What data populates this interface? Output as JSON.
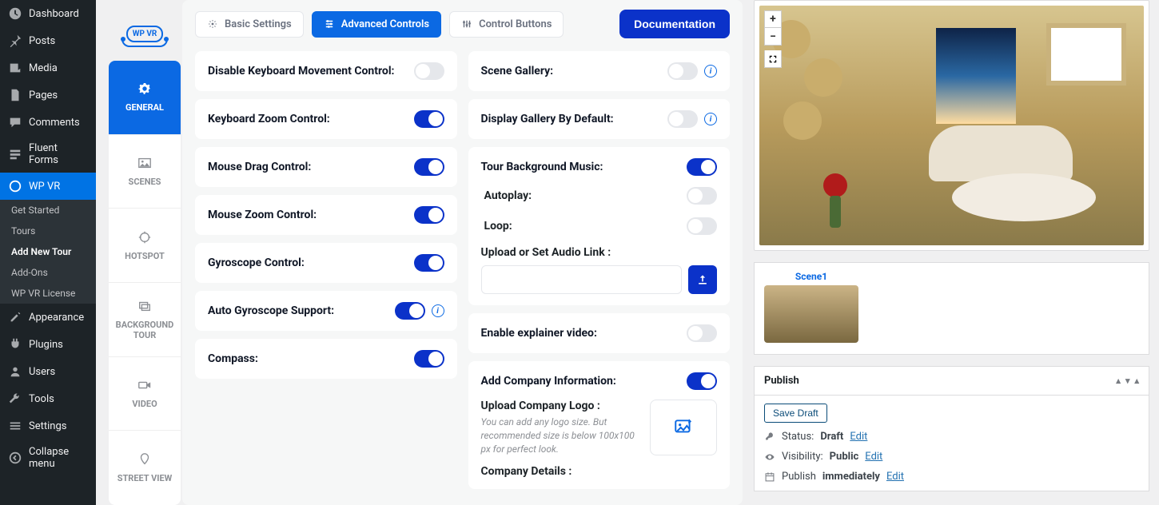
{
  "wp_menu": {
    "dashboard": "Dashboard",
    "posts": "Posts",
    "media": "Media",
    "pages": "Pages",
    "comments": "Comments",
    "fluent_forms": "Fluent Forms",
    "wp_vr": "WP VR",
    "appearance": "Appearance",
    "plugins": "Plugins",
    "users": "Users",
    "tools": "Tools",
    "settings": "Settings",
    "collapse": "Collapse menu"
  },
  "wp_vr_submenu": {
    "get_started": "Get Started",
    "tours": "Tours",
    "add_new_tour": "Add New Tour",
    "addons": "Add-Ons",
    "license": "WP VR License"
  },
  "logo_text": "WP VR",
  "side_tabs": {
    "general": "GENERAL",
    "scenes": "SCENES",
    "hotspot": "HOTSPOT",
    "background_tour": "BACKGROUND TOUR",
    "video": "VIDEO",
    "street_view": "STREET VIEW"
  },
  "top_tabs": {
    "basic": "Basic Settings",
    "advanced": "Advanced Controls",
    "control_buttons": "Control Buttons"
  },
  "doc_btn": "Documentation",
  "controls_left": {
    "disable_keyboard": {
      "label": "Disable Keyboard Movement Control:",
      "on": false
    },
    "keyboard_zoom": {
      "label": "Keyboard Zoom Control:",
      "on": true
    },
    "mouse_drag": {
      "label": "Mouse Drag Control:",
      "on": true
    },
    "mouse_zoom": {
      "label": "Mouse Zoom Control:",
      "on": true
    },
    "gyroscope": {
      "label": "Gyroscope Control:",
      "on": true
    },
    "auto_gyro": {
      "label": "Auto Gyroscope Support:",
      "on": true
    },
    "compass": {
      "label": "Compass:",
      "on": true
    }
  },
  "controls_right": {
    "scene_gallery": {
      "label": "Scene Gallery:",
      "on": false
    },
    "display_gallery": {
      "label": "Display Gallery By Default:",
      "on": false
    },
    "bg_music": {
      "label": "Tour Background Music:",
      "on": true
    },
    "autoplay": {
      "label": "Autoplay:",
      "on": false
    },
    "loop": {
      "label": "Loop:",
      "on": false
    },
    "audio_label": "Upload or Set Audio Link :",
    "audio_value": "",
    "explainer": {
      "label": "Enable explainer video:",
      "on": false
    },
    "company_info": {
      "label": "Add Company Information:",
      "on": true
    },
    "upload_logo_label": "Upload Company Logo :",
    "upload_logo_hint": "You can add any logo size. But recommended size is below 100x100 px for perfect look.",
    "company_details_label": "Company Details :"
  },
  "preview": {
    "zoom_in": "+",
    "zoom_out": "−"
  },
  "thumb": {
    "scene1": "Scene1"
  },
  "publish": {
    "title": "Publish",
    "save_draft": "Save Draft",
    "status_label": "Status:",
    "status_value": "Draft",
    "edit": "Edit",
    "visibility_label": "Visibility:",
    "visibility_value": "Public",
    "publish_label": "Publish",
    "publish_value": "immediately"
  }
}
